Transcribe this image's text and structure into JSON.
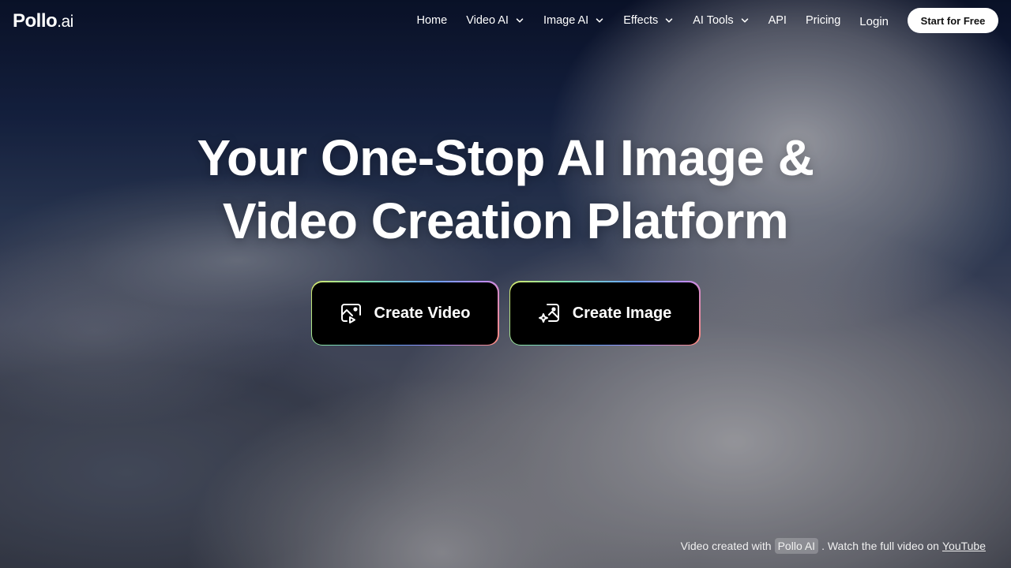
{
  "header": {
    "logo_main": "Pollo",
    "logo_suffix": ".ai",
    "nav": [
      {
        "label": "Home",
        "dropdown": false
      },
      {
        "label": "Video AI",
        "dropdown": true
      },
      {
        "label": "Image AI",
        "dropdown": true
      },
      {
        "label": "Effects",
        "dropdown": true
      },
      {
        "label": "AI Tools",
        "dropdown": true
      },
      {
        "label": "API",
        "dropdown": false
      },
      {
        "label": "Pricing",
        "dropdown": false
      }
    ],
    "login_label": "Login",
    "start_label": "Start for Free"
  },
  "hero": {
    "title_line1": "Your One-Stop AI Image &",
    "title_line2": "Video Creation Platform",
    "create_video_label": "Create Video",
    "create_video_icon": "video-image-icon",
    "create_image_label": "Create Image",
    "create_image_icon": "sparkle-image-icon"
  },
  "credit": {
    "prefix": "Video created with",
    "tag": "Pollo AI",
    "middle": ". Watch the full video on",
    "link": "YouTube"
  },
  "colors": {
    "cta_background": "#000000",
    "start_button_bg": "#ffffff"
  }
}
